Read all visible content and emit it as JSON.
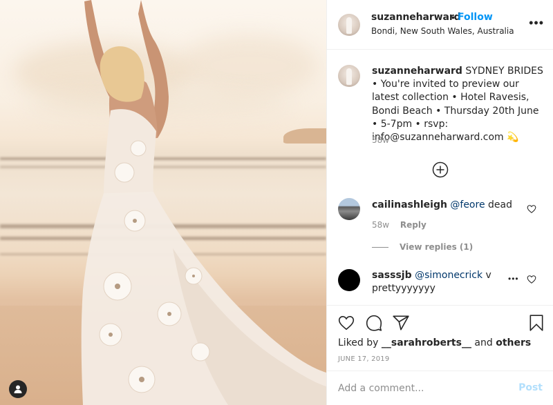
{
  "photo": {
    "alt": "Woman in white floral lace wedding gown on the beach with arms raised",
    "usertag_icon": "user-tag-icon"
  },
  "header": {
    "username": "suzanneharward",
    "separator": "•",
    "follow_label": "Follow",
    "location": "Bondi, New South Wales, Australia",
    "more_icon": "more-options-icon",
    "more_label": "•••"
  },
  "caption": {
    "username": "suzanneharward",
    "text": "SYDNEY BRIDES • You're invited to preview our latest collection • Hotel Ravesis, Bondi Beach • Thursday 20th June • 5-7pm • rsvp: info@suzanneharward.com 💫",
    "time": "58w"
  },
  "load_more_icon": "plus-circle-icon",
  "comments": [
    {
      "username": "cailinashleigh",
      "mention": "@feore",
      "text": "dead",
      "time": "58w",
      "reply_label": "Reply",
      "view_replies_label": "View replies (1)"
    },
    {
      "username": "sasssjb",
      "mention": "@simonecrick",
      "text": "v prettyyyyyyy",
      "more_label": "•••"
    }
  ],
  "actions": {
    "like_icon": "heart-icon",
    "comment_icon": "comment-icon",
    "share_icon": "paper-plane-icon",
    "save_icon": "bookmark-icon"
  },
  "likes": {
    "prefix": "Liked by",
    "user": "__sarahroberts__",
    "conjunction": "and",
    "others": "others"
  },
  "post_date": "JUNE 17, 2019",
  "add_comment": {
    "placeholder": "Add a comment...",
    "value": "",
    "post_label": "Post"
  },
  "colors": {
    "accent_blue": "#0095f6",
    "post_disabled": "#b2dffc",
    "mention": "#00376b",
    "muted": "#8e8e8e",
    "text": "#262626"
  }
}
